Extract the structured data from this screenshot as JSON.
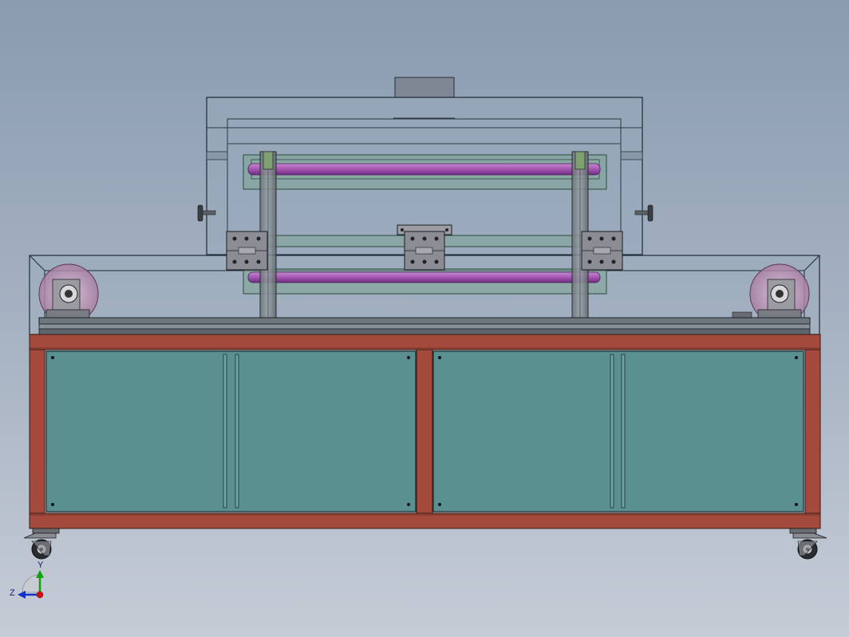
{
  "triad": {
    "y_label": "Y",
    "z_label": "Z"
  },
  "colors": {
    "background_top": "#8a9bb0",
    "background_bottom": "#c6ccd6",
    "frame": "#a44a3c",
    "door_panel": "#5a9090",
    "roller": "#a455b0",
    "tray": "#7aa290",
    "enclosure": "#98aabc",
    "bracket": "#8c8c94",
    "axis_x": "#d01010",
    "axis_y": "#10a010",
    "axis_z": "#1030d0"
  }
}
